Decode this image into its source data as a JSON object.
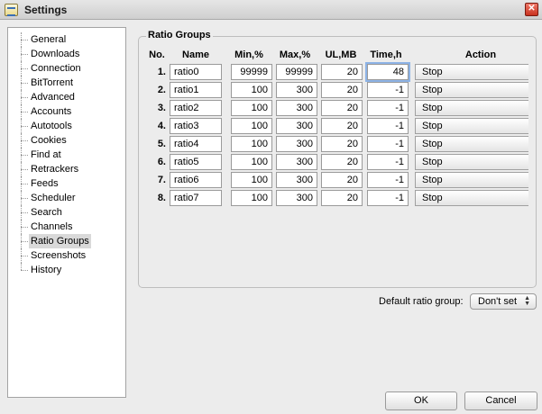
{
  "window": {
    "title": "Settings",
    "close_glyph": "✕"
  },
  "sidebar": {
    "items": [
      {
        "label": "General"
      },
      {
        "label": "Downloads"
      },
      {
        "label": "Connection"
      },
      {
        "label": "BitTorrent"
      },
      {
        "label": "Advanced"
      },
      {
        "label": "Accounts"
      },
      {
        "label": "Autotools"
      },
      {
        "label": "Cookies"
      },
      {
        "label": "Find at"
      },
      {
        "label": "Retrackers"
      },
      {
        "label": "Feeds"
      },
      {
        "label": "Scheduler"
      },
      {
        "label": "Search"
      },
      {
        "label": "Channels"
      },
      {
        "label": "Ratio Groups",
        "selected": true
      },
      {
        "label": "Screenshots"
      },
      {
        "label": "History"
      }
    ]
  },
  "ratio_groups": {
    "title": "Ratio Groups",
    "headers": {
      "no": "No.",
      "name": "Name",
      "min": "Min,%",
      "max": "Max,%",
      "ul": "UL,MB",
      "time": "Time,h",
      "action": "Action"
    },
    "rows": [
      {
        "no": "1.",
        "name": "ratio0",
        "min": "99999",
        "max": "99999",
        "ul": "20",
        "time": "48",
        "action": "Stop"
      },
      {
        "no": "2.",
        "name": "ratio1",
        "min": "100",
        "max": "300",
        "ul": "20",
        "time": "-1",
        "action": "Stop"
      },
      {
        "no": "3.",
        "name": "ratio2",
        "min": "100",
        "max": "300",
        "ul": "20",
        "time": "-1",
        "action": "Stop"
      },
      {
        "no": "4.",
        "name": "ratio3",
        "min": "100",
        "max": "300",
        "ul": "20",
        "time": "-1",
        "action": "Stop"
      },
      {
        "no": "5.",
        "name": "ratio4",
        "min": "100",
        "max": "300",
        "ul": "20",
        "time": "-1",
        "action": "Stop"
      },
      {
        "no": "6.",
        "name": "ratio5",
        "min": "100",
        "max": "300",
        "ul": "20",
        "time": "-1",
        "action": "Stop"
      },
      {
        "no": "7.",
        "name": "ratio6",
        "min": "100",
        "max": "300",
        "ul": "20",
        "time": "-1",
        "action": "Stop"
      },
      {
        "no": "8.",
        "name": "ratio7",
        "min": "100",
        "max": "300",
        "ul": "20",
        "time": "-1",
        "action": "Stop"
      }
    ]
  },
  "default_group": {
    "label": "Default ratio group:",
    "value": "Don't set"
  },
  "buttons": {
    "ok": "OK",
    "cancel": "Cancel"
  }
}
